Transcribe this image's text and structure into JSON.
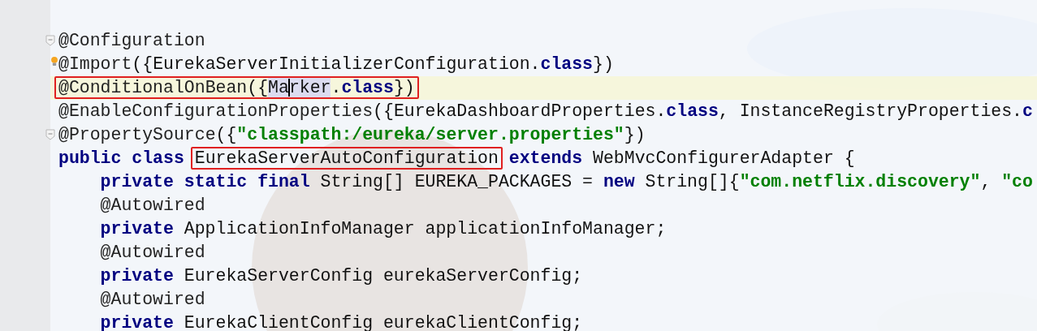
{
  "editor": {
    "lines": [
      {
        "foldable": true,
        "bulb": false,
        "current": false,
        "segments": [
          {
            "kind": "annotation",
            "text": "@Configuration"
          }
        ]
      },
      {
        "foldable": false,
        "bulb": true,
        "current": false,
        "segments": [
          {
            "kind": "annotation",
            "text": "@Import"
          },
          {
            "kind": "plain",
            "text": "({EurekaServerInitializerConfiguration."
          },
          {
            "kind": "keyword",
            "text": "class"
          },
          {
            "kind": "plain",
            "text": "})"
          }
        ]
      },
      {
        "foldable": false,
        "bulb": false,
        "current": true,
        "segments": [
          {
            "kind": "box",
            "parts": [
              {
                "kind": "annotation",
                "text": "@ConditionalOnBean"
              },
              {
                "kind": "plain",
                "text": "({"
              },
              {
                "kind": "selection",
                "text": "Ma"
              },
              {
                "kind": "caret"
              },
              {
                "kind": "selection",
                "text": "rker"
              },
              {
                "kind": "plain",
                "text": "."
              },
              {
                "kind": "keyword",
                "text": "class"
              },
              {
                "kind": "plain",
                "text": "})"
              }
            ]
          }
        ]
      },
      {
        "foldable": false,
        "bulb": false,
        "current": false,
        "segments": [
          {
            "kind": "annotation",
            "text": "@EnableConfigurationProperties"
          },
          {
            "kind": "plain",
            "text": "({EurekaDashboardProperties."
          },
          {
            "kind": "keyword",
            "text": "class"
          },
          {
            "kind": "plain",
            "text": ", InstanceRegistryProperties."
          },
          {
            "kind": "keyword",
            "text": "c"
          }
        ]
      },
      {
        "foldable": true,
        "bulb": false,
        "current": false,
        "segments": [
          {
            "kind": "annotation",
            "text": "@PropertySource"
          },
          {
            "kind": "plain",
            "text": "({"
          },
          {
            "kind": "string",
            "text": "\"classpath:/eureka/server.properties\""
          },
          {
            "kind": "plain",
            "text": "})"
          }
        ]
      },
      {
        "foldable": false,
        "bulb": false,
        "current": false,
        "segments": [
          {
            "kind": "keyword",
            "text": "public class "
          },
          {
            "kind": "box",
            "parts": [
              {
                "kind": "plain",
                "text": "EurekaServerAutoConfiguration"
              }
            ]
          },
          {
            "kind": "keyword",
            "text": " extends "
          },
          {
            "kind": "plain",
            "text": "WebMvcConfigurerAdapter {"
          }
        ],
        "children": [
          {
            "foldable": false,
            "bulb": false,
            "current": false,
            "segments": [
              {
                "kind": "keyword",
                "text": "private static final "
              },
              {
                "kind": "plain",
                "text": "String[] EUREKA_PACKAGES = "
              },
              {
                "kind": "keyword",
                "text": "new "
              },
              {
                "kind": "plain",
                "text": "String[]{"
              },
              {
                "kind": "string",
                "text": "\"com.netflix.discovery\""
              },
              {
                "kind": "plain",
                "text": ", "
              },
              {
                "kind": "string",
                "text": "\"co"
              }
            ]
          },
          {
            "foldable": false,
            "bulb": false,
            "current": false,
            "segments": [
              {
                "kind": "annotation",
                "text": "@Autowired"
              }
            ]
          },
          {
            "foldable": false,
            "bulb": false,
            "current": false,
            "segments": [
              {
                "kind": "keyword",
                "text": "private "
              },
              {
                "kind": "plain",
                "text": "ApplicationInfoManager applicationInfoManager;"
              }
            ]
          },
          {
            "foldable": false,
            "bulb": false,
            "current": false,
            "segments": [
              {
                "kind": "annotation",
                "text": "@Autowired"
              }
            ]
          },
          {
            "foldable": false,
            "bulb": false,
            "current": false,
            "segments": [
              {
                "kind": "keyword",
                "text": "private "
              },
              {
                "kind": "plain",
                "text": "EurekaServerConfig eurekaServerConfig;"
              }
            ]
          },
          {
            "foldable": false,
            "bulb": false,
            "current": false,
            "segments": [
              {
                "kind": "annotation",
                "text": "@Autowired"
              }
            ]
          },
          {
            "foldable": false,
            "bulb": false,
            "current": false,
            "segments": [
              {
                "kind": "keyword",
                "text": "private "
              },
              {
                "kind": "plain",
                "text": "EurekaClientConfig eurekaClientConfig;"
              }
            ]
          }
        ]
      }
    ]
  }
}
